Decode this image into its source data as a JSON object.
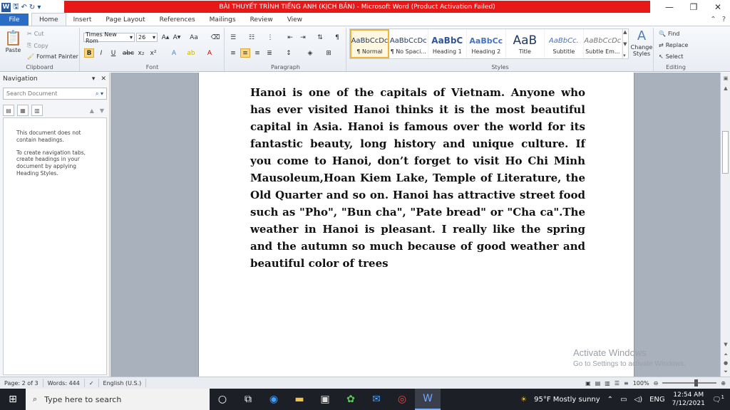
{
  "window": {
    "title": "BÀI THUYẾT TRÌNH TIẾNG ANH (KỊCH BẢN) - Microsoft Word (Product Activation Failed)"
  },
  "tabs": [
    "File",
    "Home",
    "Insert",
    "Page Layout",
    "References",
    "Mailings",
    "Review",
    "View"
  ],
  "ribbon": {
    "clipboard": {
      "paste": "Paste",
      "cut": "Cut",
      "copy": "Copy",
      "format_painter": "Format Painter",
      "label": "Clipboard"
    },
    "font": {
      "name": "Times New Rom",
      "size": "26",
      "label": "Font"
    },
    "paragraph": {
      "label": "Paragraph"
    },
    "styles": {
      "label": "Styles",
      "items": [
        {
          "preview": "AaBbCcDc",
          "name": "¶ Normal"
        },
        {
          "preview": "AaBbCcDc",
          "name": "¶ No Spaci..."
        },
        {
          "preview": "AaBbC",
          "name": "Heading 1"
        },
        {
          "preview": "AaBbCc",
          "name": "Heading 2"
        },
        {
          "preview": "AaB",
          "name": "Title"
        },
        {
          "preview": "AaBbCc.",
          "name": "Subtitle"
        },
        {
          "preview": "AaBbCcDc",
          "name": "Subtle Em..."
        }
      ],
      "change": "Change Styles"
    },
    "editing": {
      "find": "Find",
      "replace": "Replace",
      "select": "Select",
      "label": "Editing"
    }
  },
  "nav": {
    "title": "Navigation",
    "search_placeholder": "Search Document",
    "msg1": "This document does not contain headings.",
    "msg2": "To create navigation tabs, create headings in your document by applying Heading Styles."
  },
  "document": {
    "text": "Hanoi is one of the capitals of Vietnam. Anyone who has ever visited Hanoi thinks it is the most beautiful capital in Asia. Hanoi is famous over the world for its fantastic beauty, long history and unique culture. If you come to Hanoi, don’t forget to visit Ho Chi Minh Mausoleum,Hoan Kiem Lake, Temple of Literature, the Old Quarter and so on. Hanoi has attractive street food such as \"Pho\", \"Bun cha\", \"Pate bread\" or \"Cha ca\".The weather in Hanoi is pleasant. I really like the spring and the autumn so much because of good weather and beautiful color of trees"
  },
  "watermark": {
    "line1": "Activate Windows",
    "line2": "Go to Settings to activate Windows."
  },
  "status": {
    "page": "Page: 2 of 3",
    "words": "Words: 444",
    "language": "English (U.S.)",
    "zoom": "100%"
  },
  "taskbar": {
    "search": "Type here to search",
    "weather": "95°F  Mostly sunny",
    "lang": "ENG",
    "time": "12:54 AM",
    "date": "7/12/2021",
    "notif": "1"
  }
}
